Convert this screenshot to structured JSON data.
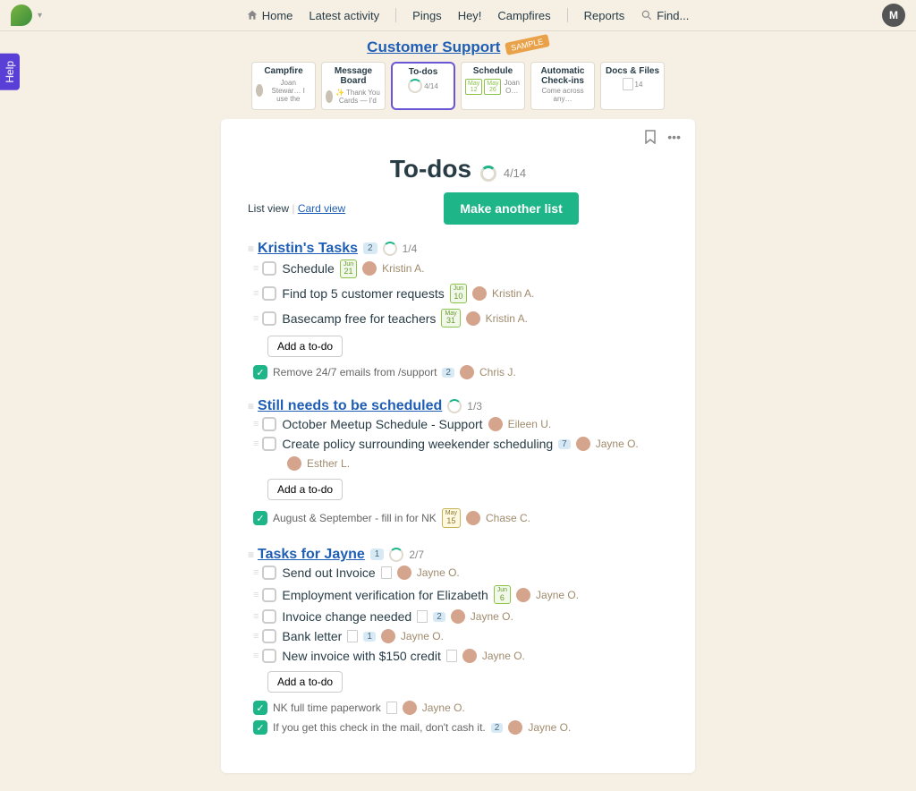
{
  "topnav": {
    "home": "Home",
    "activity": "Latest activity",
    "pings": "Pings",
    "hey": "Hey!",
    "campfires": "Campfires",
    "reports": "Reports",
    "find_placeholder": "Find...",
    "avatar_initial": "M"
  },
  "help": "Help",
  "project": {
    "title": "Customer Support",
    "sample": "SAMPLE"
  },
  "tools": {
    "campfire": {
      "title": "Campfire",
      "sub": "Joan Stewar… I use the"
    },
    "message": {
      "title": "Message Board",
      "sub": "✨ Thank You Cards — I'd"
    },
    "todos": {
      "title": "To-dos",
      "count": "4/14"
    },
    "schedule": {
      "title": "Schedule",
      "sub": "Joan O…",
      "d1m": "May",
      "d1d": "12",
      "d2m": "May",
      "d2d": "26"
    },
    "checkins": {
      "title": "Automatic Check-ins",
      "sub": "Come across any…"
    },
    "docs": {
      "title": "Docs & Files",
      "count": "14"
    }
  },
  "page": {
    "title": "To-dos",
    "progress": "4/14",
    "list_view": "List view",
    "card_view": "Card view",
    "make_another": "Make another list",
    "add_todo": "Add a to-do"
  },
  "lists": [
    {
      "title": "Kristin's Tasks",
      "badge": "2",
      "progress": "1/4",
      "items": [
        {
          "text": "Schedule",
          "date_m": "Jun",
          "date_d": "21",
          "assignee": "Kristin A."
        },
        {
          "text": "Find top 5 customer requests",
          "date_m": "Jun",
          "date_d": "10",
          "assignee": "Kristin A."
        },
        {
          "text": "Basecamp free for teachers",
          "date_m": "May",
          "date_d": "31",
          "assignee": "Kristin A."
        }
      ],
      "done": [
        {
          "text": "Remove 24/7 emails from /support",
          "badge": "2",
          "assignee": "Chris J."
        }
      ]
    },
    {
      "title": "Still needs to be scheduled",
      "progress": "1/3",
      "items": [
        {
          "text": "October Meetup Schedule - Support",
          "assignee": "Eileen U."
        },
        {
          "text": "Create policy surrounding weekender scheduling",
          "badge": "7",
          "assignee": "Jayne O.",
          "extra_assignee": "Esther L."
        }
      ],
      "done": [
        {
          "text": "August & September - fill in for NK",
          "date_m": "May",
          "date_d": "15",
          "assignee": "Chase C."
        }
      ]
    },
    {
      "title": "Tasks for Jayne",
      "badge": "1",
      "progress": "2/7",
      "items": [
        {
          "text": "Send out Invoice",
          "doc": true,
          "assignee": "Jayne O."
        },
        {
          "text": "Employment verification for Elizabeth",
          "date_m": "Jun",
          "date_d": "6",
          "assignee": "Jayne O."
        },
        {
          "text": "Invoice change needed",
          "doc": true,
          "badge": "2",
          "assignee": "Jayne O."
        },
        {
          "text": "Bank letter",
          "doc": true,
          "badge": "1",
          "assignee": "Jayne O."
        },
        {
          "text": "New invoice with $150 credit",
          "doc": true,
          "assignee": "Jayne O."
        }
      ],
      "done": [
        {
          "text": "NK full time paperwork",
          "doc": true,
          "assignee": "Jayne O."
        },
        {
          "text": "If you get this check in the mail, don't cash it.",
          "badge": "2",
          "assignee": "Jayne O."
        }
      ]
    }
  ]
}
